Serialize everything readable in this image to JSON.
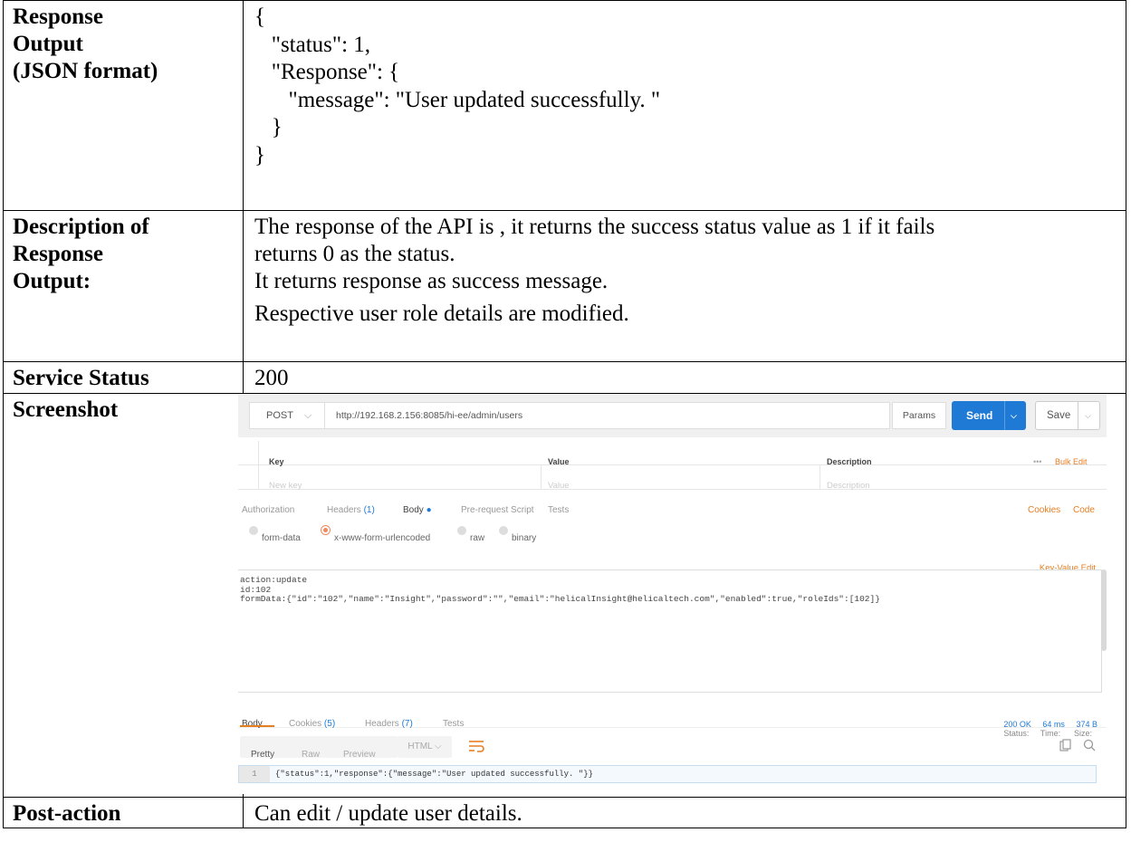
{
  "rows": {
    "response": {
      "label_lines": [
        "Response",
        "Output",
        "(JSON format)"
      ],
      "json_lines": [
        "{",
        "   \"status\": 1,",
        "   \"Response\": {",
        "      \"message\": \"User updated successfully. \"",
        "   }",
        "}"
      ]
    },
    "description": {
      "label_lines": [
        "Description of",
        "Response",
        "Output:"
      ],
      "lines": [
        "The response of the API is , it returns the success status value as 1 if it fails",
        "returns 0 as the status.",
        "It returns response as success message.",
        "Respective user role details are modified."
      ]
    },
    "service_status": {
      "label": "Service Status",
      "value": "200"
    },
    "screenshot": {
      "label": "Screenshot"
    },
    "post_action": {
      "label": "Post-action",
      "value": "Can edit / update user details."
    }
  },
  "postman": {
    "method": "POST",
    "url": "http://192.168.2.156:8085/hi-ee/admin/users",
    "params_label": "Params",
    "send_label": "Send",
    "save_label": "Save",
    "kv_headers": {
      "key": "Key",
      "value": "Value",
      "description": "Description",
      "more": "•••",
      "bulk_edit": "Bulk Edit"
    },
    "kv_placeholders": {
      "key": "New key",
      "value": "Value",
      "description": "Description"
    },
    "request_tabs": {
      "authorization": "Authorization",
      "headers": "Headers",
      "headers_count": "(1)",
      "body": "Body",
      "prerequest": "Pre-request Script",
      "tests": "Tests",
      "cookies": "Cookies",
      "code": "Code"
    },
    "body_types": {
      "form_data": "form-data",
      "urlencoded": "x-www-form-urlencoded",
      "raw": "raw",
      "binary": "binary",
      "selected": "x-www-form-urlencoded"
    },
    "key_value_edit": "Key-Value Edit",
    "body_lines": [
      "action:update",
      "id:102",
      "formData:{\"id\":\"102\",\"name\":\"Insight\",\"password\":\"\",\"email\":\"helicalInsight@helicaltech.com\",\"enabled\":true,\"roleIds\":[102]}"
    ],
    "response_tabs": {
      "body": "Body",
      "cookies": "Cookies",
      "cookies_count": "(5)",
      "headers": "Headers",
      "headers_count": "(7)",
      "tests": "Tests"
    },
    "status": {
      "status_label": "Status:",
      "status_value": "200 OK",
      "time_label": "Time:",
      "time_value": "64 ms",
      "size_label": "Size:",
      "size_value": "374 B"
    },
    "format": {
      "pretty": "Pretty",
      "raw": "Raw",
      "preview": "Preview",
      "html": "HTML"
    },
    "response_line_number": "1",
    "response_code": "{\"status\":1,\"response\":{\"message\":\"User updated successfully. \"}}",
    "colors": {
      "send": "#1f7ad6",
      "accent": "#e67e22",
      "link": "#1f7ad6"
    }
  }
}
